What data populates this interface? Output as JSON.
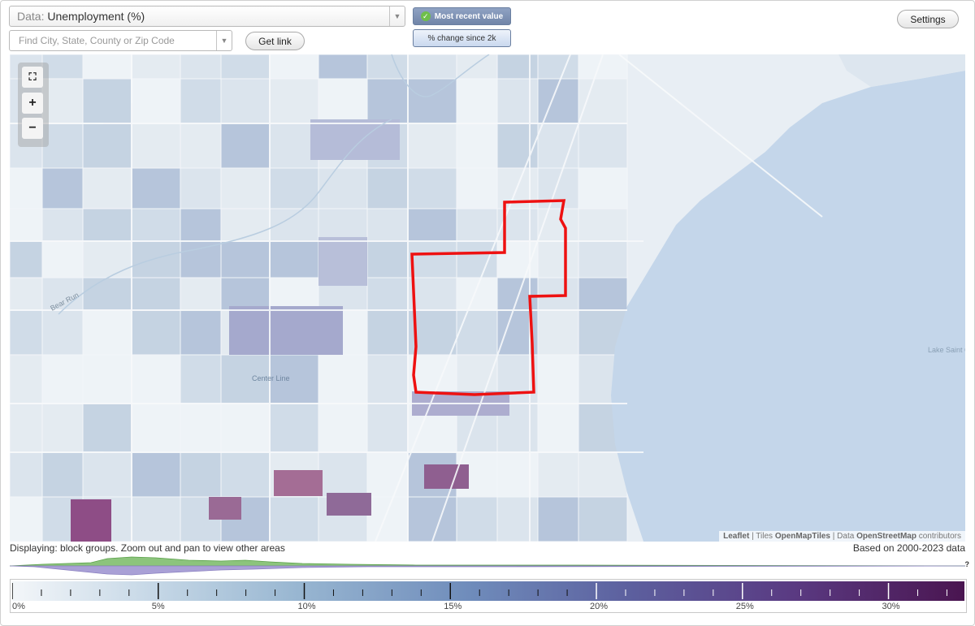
{
  "data_select": {
    "prefix": "Data:",
    "value": "Unemployment (%)"
  },
  "search": {
    "placeholder": "Find City, State, County or Zip Code"
  },
  "buttons": {
    "get_link": "Get link",
    "settings": "Settings"
  },
  "toggles": {
    "most_recent": "Most recent value",
    "pct_change": "% change since 2k"
  },
  "map": {
    "labels": {
      "river": "Bear Run",
      "city": "Center Line",
      "lake": "Lake Saint C"
    },
    "attribution": {
      "leaflet": "Leaflet",
      "sep1": " | Tiles ",
      "tiles": "OpenMapTiles",
      "sep2": " | Data ",
      "data": "OpenStreetMap",
      "sep3": " contributors"
    },
    "colors": {
      "highlight_outline": "#ee1111",
      "water": "#c4d6ea"
    }
  },
  "status": {
    "displaying": "Displaying: block groups. Zoom out and pan to view other areas",
    "data_range": "Based on 2000-2023 data"
  },
  "legend": {
    "tick_labels": [
      "0%",
      "5%",
      "10%",
      "15%",
      "20%",
      "25%",
      "30%"
    ],
    "tick_values": [
      0,
      5,
      10,
      15,
      20,
      25,
      30
    ],
    "max_value": 32.6,
    "help": "?"
  }
}
